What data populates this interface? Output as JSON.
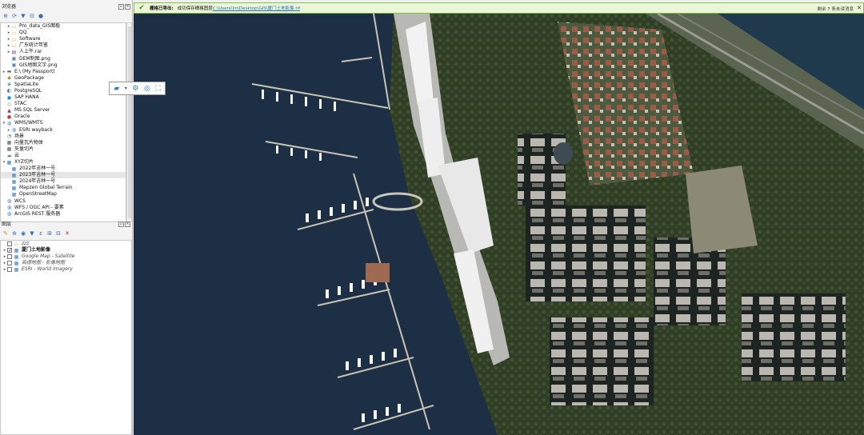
{
  "browser": {
    "title": "浏览器",
    "items": [
      {
        "label": "Pro_data_GIS图板",
        "icon": "folder-icon",
        "indent": 1,
        "arrow": "▸"
      },
      {
        "label": "QQ",
        "icon": "folder-icon",
        "indent": 1,
        "arrow": "▸"
      },
      {
        "label": "Software",
        "icon": "folder-icon",
        "indent": 1,
        "arrow": "▸"
      },
      {
        "label": "广东统计年鉴",
        "icon": "folder-icon",
        "indent": 1,
        "arrow": "▸"
      },
      {
        "label": "人上午.rar",
        "icon": "archive-icon",
        "indent": 1,
        "arrow": "▸"
      },
      {
        "label": "DEM制图.png",
        "icon": "image-icon",
        "indent": 1,
        "arrow": ""
      },
      {
        "label": "GIS地图文字.png",
        "icon": "image-icon",
        "indent": 1,
        "arrow": ""
      },
      {
        "label": "E:\\ (My Passport)",
        "icon": "drive-icon",
        "indent": 0,
        "arrow": "▸"
      },
      {
        "label": "GeoPackage",
        "icon": "geopackage-icon",
        "indent": 0,
        "arrow": ""
      },
      {
        "label": "SpatiaLite",
        "icon": "spatialite-icon",
        "indent": 0,
        "arrow": ""
      },
      {
        "label": "PostgreSQL",
        "icon": "postgresql-icon",
        "indent": 0,
        "arrow": ""
      },
      {
        "label": "SAP HANA",
        "icon": "saphana-icon",
        "indent": 0,
        "arrow": ""
      },
      {
        "label": "STAC",
        "icon": "stac-icon",
        "indent": 0,
        "arrow": ""
      },
      {
        "label": "MS SQL Server",
        "icon": "mssql-icon",
        "indent": 0,
        "arrow": ""
      },
      {
        "label": "Oracle",
        "icon": "oracle-icon",
        "indent": 0,
        "arrow": ""
      },
      {
        "label": "WMS/WMTS",
        "icon": "wms-icon",
        "indent": 0,
        "arrow": "▾"
      },
      {
        "label": "ESRI wayback",
        "icon": "wms-icon",
        "indent": 1,
        "arrow": "▸"
      },
      {
        "label": "场景",
        "icon": "scene-icon",
        "indent": 0,
        "arrow": ""
      },
      {
        "label": "向量瓦片物体",
        "icon": "vectortile-icon",
        "indent": 0,
        "arrow": ""
      },
      {
        "label": "矢量切片",
        "icon": "vectortile-icon",
        "indent": 0,
        "arrow": ""
      },
      {
        "label": "云",
        "icon": "cloud-icon",
        "indent": 0,
        "arrow": ""
      },
      {
        "label": "XYZ切片",
        "icon": "xyz-icon",
        "indent": 0,
        "arrow": "▾"
      },
      {
        "label": "2022年吉林一号",
        "icon": "tile-grid-icon",
        "indent": 1,
        "arrow": ""
      },
      {
        "label": "2023年吉林一号",
        "icon": "tile-grid-icon",
        "indent": 1,
        "arrow": "",
        "selected": true
      },
      {
        "label": "2024年吉林一号",
        "icon": "tile-grid-icon",
        "indent": 1,
        "arrow": ""
      },
      {
        "label": "Mapzen Global Terrain",
        "icon": "tile-grid-icon",
        "indent": 1,
        "arrow": ""
      },
      {
        "label": "OpenStreetMap",
        "icon": "tile-grid-icon",
        "indent": 1,
        "arrow": ""
      },
      {
        "label": "WCS",
        "icon": "wcs-icon",
        "indent": 0,
        "arrow": ""
      },
      {
        "label": "WFS / OGC API - 要素",
        "icon": "wfs-icon",
        "indent": 0,
        "arrow": ""
      },
      {
        "label": "ArcGIS REST 服务器",
        "icon": "arcgis-icon",
        "indent": 0,
        "arrow": ""
      }
    ]
  },
  "layers": {
    "title": "图层",
    "items": [
      {
        "label": "zzz",
        "checked": false,
        "style": "italic",
        "expander": ""
      },
      {
        "label": "厦门土地影像",
        "checked": true,
        "style": "bold",
        "expander": "▸"
      },
      {
        "label": "Google Map - Satellite",
        "checked": false,
        "style": "italic",
        "expander": "▸"
      },
      {
        "label": "高德地图 - 影像地图",
        "checked": false,
        "style": "italic",
        "expander": "▸"
      },
      {
        "label": "ESRI - World Imagery",
        "checked": false,
        "style": "italic",
        "expander": "▸"
      }
    ]
  },
  "message": {
    "title": "栅格已导出:",
    "text": "成功保存栅格图层",
    "path": "C:\\Users\\lin\\Desktop\\GIS\\厦门土地影像.tif",
    "right_text": "剩余 7 条未读消息"
  },
  "colors": {
    "sea": "#1c2f45",
    "message_bg": "#eaf6d6",
    "message_border": "#7ec24b",
    "accent": "#2f7dcc"
  }
}
